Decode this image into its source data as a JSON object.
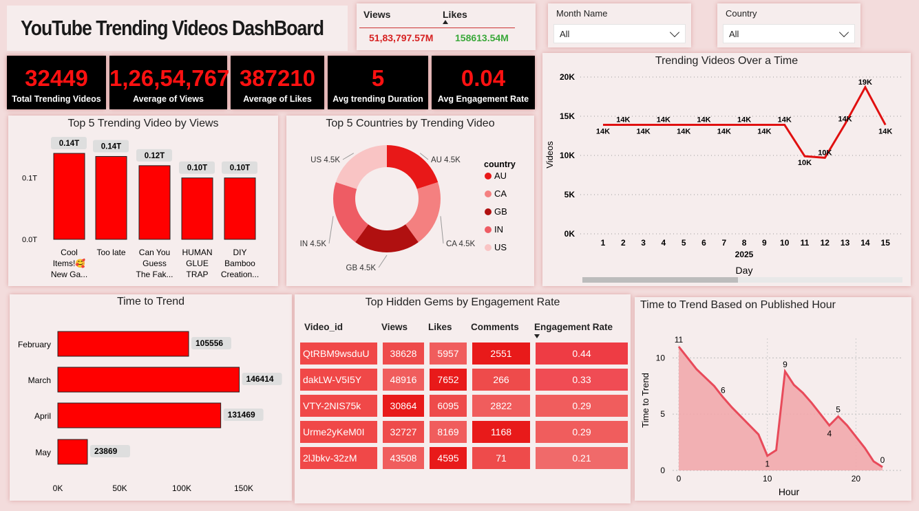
{
  "header": {
    "title": "YouTube Trending Videos DashBoard",
    "logo": "youtube-logo-icon"
  },
  "summary": {
    "views_label": "Views",
    "likes_label": "Likes",
    "views_value": "51,83,797.57M",
    "likes_value": "158613.54M",
    "views_color": "#d62020",
    "likes_color": "#3aa83a"
  },
  "filters": {
    "month": {
      "label": "Month Name",
      "value": "All"
    },
    "country": {
      "label": "Country",
      "value": "All"
    }
  },
  "kpis": [
    {
      "value": "32449",
      "label": "Total Trending Videos"
    },
    {
      "value": "1,26,54,767",
      "label": "Average of Views"
    },
    {
      "value": "387210",
      "label": "Average of Likes"
    },
    {
      "value": "5",
      "label": "Avg trending Duration"
    },
    {
      "value": "0.04",
      "label": "Avg Engagement Rate"
    }
  ],
  "colors": {
    "accent": "#ff0000",
    "kpi_bg": "#000000",
    "panel_bg": "#f6eded",
    "page_bg": "#f3dcdc"
  },
  "top5_views": {
    "title": "Top 5 Trending Video by Views",
    "chart_data": {
      "type": "bar",
      "categories": [
        [
          "Cool",
          "Items!🥰",
          "New Ga..."
        ],
        [
          "Too late"
        ],
        [
          "Can You",
          "Guess",
          "The Fak..."
        ],
        [
          "HUMAN",
          "GLUE",
          "TRAP"
        ],
        [
          "DIY",
          "Bamboo",
          "Creation..."
        ]
      ],
      "values": [
        0.14,
        0.135,
        0.12,
        0.1,
        0.1
      ],
      "data_labels": [
        "0.14T",
        "0.14T",
        "0.12T",
        "0.10T",
        "0.10T"
      ],
      "y_ticks": [
        "0.1T",
        "0.0T"
      ],
      "ylim": [
        0,
        0.14
      ]
    }
  },
  "top5_countries": {
    "title": "Top 5 Countries by Trending Video",
    "legend_title": "country",
    "chart_data": {
      "type": "pie",
      "slices": [
        {
          "name": "AU",
          "value": 4.5,
          "label": "AU 4.5K",
          "color": "#e81818"
        },
        {
          "name": "CA",
          "value": 4.5,
          "label": "CA 4.5K",
          "color": "#f48080"
        },
        {
          "name": "GB",
          "value": 4.5,
          "label": "GB 4.5K",
          "color": "#b01010"
        },
        {
          "name": "IN",
          "value": 4.5,
          "label": "IN 4.5K",
          "color": "#ee5c64"
        },
        {
          "name": "US",
          "value": 4.5,
          "label": "US 4.5K",
          "color": "#f9c4c4"
        }
      ],
      "legend_position": "right"
    }
  },
  "trend_over_time": {
    "title": "Trending Videos Over a Time",
    "chart_data": {
      "type": "line",
      "x": [
        1,
        2,
        3,
        4,
        5,
        6,
        7,
        8,
        9,
        10,
        11,
        12,
        13,
        14,
        15
      ],
      "values": [
        13900,
        13900,
        13900,
        13900,
        13900,
        13900,
        13900,
        13900,
        13900,
        13900,
        9900,
        9700,
        14000,
        18700,
        13900
      ],
      "data_labels": [
        "14K",
        "14K",
        "14K",
        "14K",
        "14K",
        "14K",
        "14K",
        "14K",
        "14K",
        "14K",
        "10K",
        "10K",
        "14K",
        "19K",
        "14K"
      ],
      "y_ticks": [
        "20K",
        "15K",
        "10K",
        "5K",
        "0K"
      ],
      "ylim": [
        0,
        20000
      ],
      "xlabel": "Day",
      "x_group_label": "2025",
      "ylabel": "Videos",
      "grid": true
    }
  },
  "time_to_trend": {
    "title": "Time to Trend",
    "chart_data": {
      "type": "bar",
      "orientation": "horizontal",
      "categories": [
        "February",
        "March",
        "April",
        "May"
      ],
      "values": [
        105556,
        146414,
        131469,
        23869
      ],
      "data_labels": [
        "105556",
        "146414",
        "131469",
        "23869"
      ],
      "x_ticks": [
        "0K",
        "50K",
        "100K",
        "150K"
      ],
      "xlim": [
        0,
        150000
      ]
    }
  },
  "hidden_gems": {
    "title": "Top Hidden Gems by Engagement Rate",
    "columns": [
      "Video_id",
      "Views",
      "Likes",
      "Comments",
      "Engagement Rate"
    ],
    "rows": [
      [
        "QtRBM9wsduU",
        "38628",
        "5957",
        "2551",
        "0.44"
      ],
      [
        "dakLW-V5I5Y",
        "48916",
        "7652",
        "266",
        "0.33"
      ],
      [
        "VTY-2NIS75k",
        "30864",
        "6095",
        "2822",
        "0.29"
      ],
      [
        "Urme2yKeM0I",
        "32727",
        "8169",
        "1168",
        "0.29"
      ],
      [
        "2lJbkv-32zM",
        "43508",
        "4595",
        "71",
        "0.21"
      ]
    ]
  },
  "published_hour": {
    "title": "Time to Trend Based on Published Hour",
    "chart_data": {
      "type": "area",
      "x": [
        0,
        2,
        4,
        5,
        6,
        8,
        9,
        10,
        11,
        12,
        13,
        14,
        15,
        16,
        17,
        18,
        19,
        20,
        21,
        22,
        23
      ],
      "values": [
        11,
        9,
        7.5,
        6.5,
        5.6,
        4,
        3.2,
        1.3,
        1.8,
        8.8,
        7.6,
        6.9,
        6,
        5,
        4,
        4.8,
        4,
        3,
        2,
        0.8,
        0.3
      ],
      "annotations": [
        {
          "x": 0,
          "label": "11"
        },
        {
          "x": 5,
          "label": "6"
        },
        {
          "x": 10,
          "label": "1"
        },
        {
          "x": 12,
          "label": "9"
        },
        {
          "x": 17,
          "label": "4"
        },
        {
          "x": 18,
          "label": "5"
        },
        {
          "x": 23,
          "label": "0"
        }
      ],
      "x_ticks": [
        "0",
        "10",
        "20"
      ],
      "y_ticks": [
        "10",
        "5",
        "0"
      ],
      "xlim": [
        0,
        23
      ],
      "ylim": [
        0,
        11
      ],
      "xlabel": "Hour",
      "ylabel": "Time to Trend",
      "grid": true
    }
  }
}
